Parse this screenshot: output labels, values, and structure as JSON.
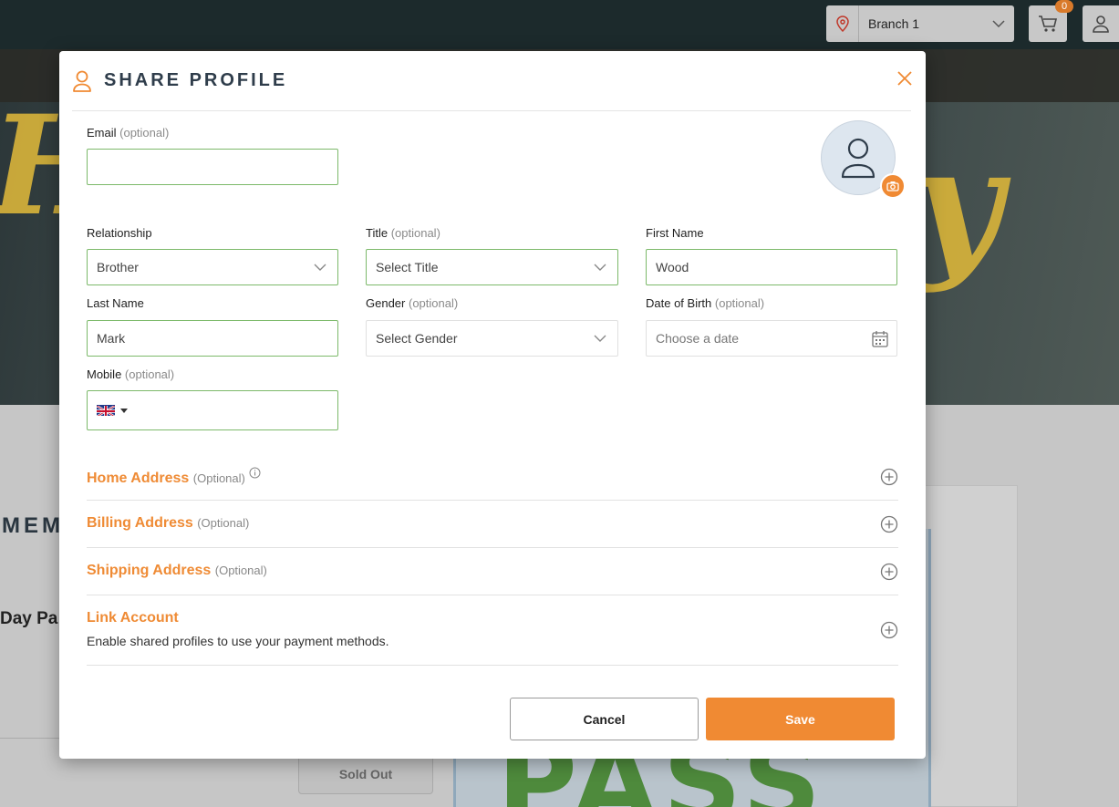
{
  "background": {
    "branch_select": {
      "value": "Branch 1"
    },
    "cart_badge": "0",
    "members_heading": "MEM",
    "day_pass_heading": "Day Pa",
    "sold_out_label": "Sold Out",
    "pass_text": "PASS"
  },
  "modal": {
    "title": "SHARE PROFILE",
    "icons": {
      "header": "user-icon",
      "close": "close-icon",
      "avatar": "user-icon",
      "camera": "camera-icon",
      "dropdown": "chevron-down-icon",
      "calendar": "calendar-icon",
      "expand": "plus-circle-icon",
      "info": "info-icon"
    },
    "accent_color": "#f08a33",
    "valid_border_color": "#7cb96a",
    "fields": {
      "email": {
        "label": "Email",
        "optional": "(optional)",
        "value": ""
      },
      "relationship": {
        "label": "Relationship",
        "value": "Brother"
      },
      "title": {
        "label": "Title",
        "optional": "(optional)",
        "placeholder": "Select Title"
      },
      "first_name": {
        "label": "First Name",
        "value": "Wood"
      },
      "last_name": {
        "label": "Last Name",
        "value": "Mark"
      },
      "gender": {
        "label": "Gender",
        "optional": "(optional)",
        "placeholder": "Select Gender"
      },
      "dob": {
        "label": "Date of Birth",
        "optional": "(optional)",
        "placeholder": "Choose a date"
      },
      "mobile": {
        "label": "Mobile",
        "optional": "(optional)",
        "country": "GB",
        "value": ""
      }
    },
    "sections": [
      {
        "title": "Home Address",
        "optional": "(Optional)"
      },
      {
        "title": "Billing Address",
        "optional": "(Optional)"
      },
      {
        "title": "Shipping Address",
        "optional": "(Optional)"
      },
      {
        "title": "Link Account",
        "description": "Enable shared profiles to use your payment methods."
      }
    ],
    "buttons": {
      "cancel": "Cancel",
      "save": "Save"
    }
  }
}
